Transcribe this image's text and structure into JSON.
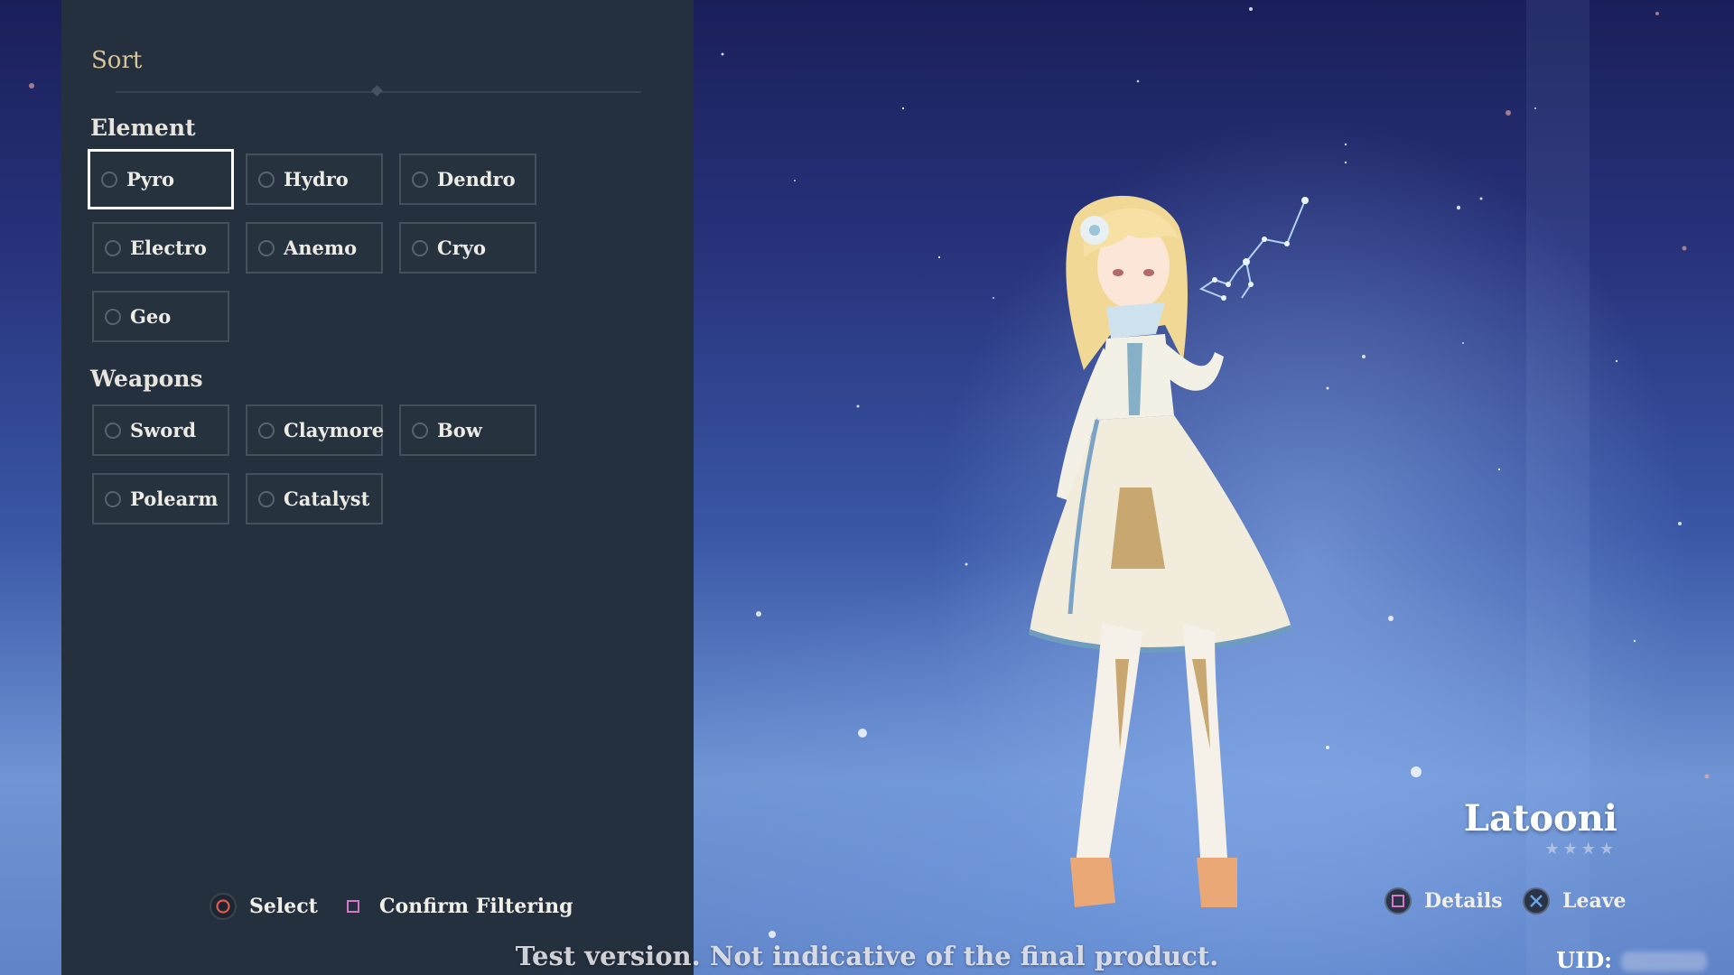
{
  "sort_panel": {
    "title": "Sort",
    "element_heading": "Element",
    "elements": [
      "Pyro",
      "Hydro",
      "Dendro",
      "Electro",
      "Anemo",
      "Cryo",
      "Geo"
    ],
    "weapons_heading": "Weapons",
    "weapons": [
      "Sword",
      "Claymore",
      "Bow",
      "Polearm",
      "Catalyst"
    ],
    "selected": "Pyro"
  },
  "panel_hints": {
    "select_label": "Select",
    "select_icon": "circle-button-icon",
    "confirm_label": "Confirm Filtering",
    "confirm_icon": "square-button-icon"
  },
  "character": {
    "name": "Latooni",
    "rarity_stars": 4
  },
  "character_hints": {
    "details_label": "Details",
    "details_icon": "square-button-icon",
    "leave_label": "Leave",
    "leave_icon": "cross-button-icon"
  },
  "footer": {
    "watermark": "Test version. Not indicative of the final product.",
    "uid_label": "UID:"
  },
  "colors": {
    "panel_bg": "#25303f",
    "title_gold": "#d8c59a",
    "circle_red": "#e05a50",
    "square_pink": "#d678c8",
    "cross_blue": "#6aa4e8"
  }
}
